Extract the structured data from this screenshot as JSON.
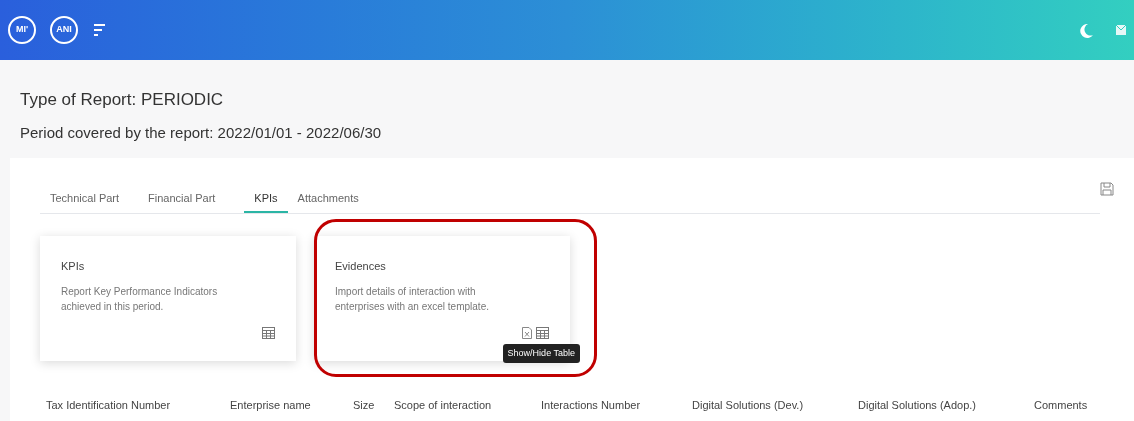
{
  "header": {
    "logos": [
      {
        "text": "MI'"
      },
      {
        "text": "ANI"
      }
    ]
  },
  "report": {
    "type": "Type of Report: PERIODIC",
    "period": "Period covered by the report: 2022/01/01 - 2022/06/30"
  },
  "tabs": [
    {
      "label": "Technical Part",
      "selected": false
    },
    {
      "label": "Financial Part",
      "selected": false
    },
    {
      "label": "KPIs",
      "selected": true
    },
    {
      "label": "Attachments",
      "selected": false
    }
  ],
  "cards": [
    {
      "title": "KPIs",
      "description": "Report Key Performance Indicators achieved in this period.",
      "excel_icon": false,
      "highlighted": false
    },
    {
      "title": "Evidences",
      "description": "Import details of interaction with enterprises with an excel template.",
      "excel_icon": true,
      "highlighted": true,
      "tooltip": "Show/Hide Table"
    }
  ],
  "table": {
    "columns": [
      "Tax Identification Number",
      "Enterprise name",
      "Size",
      "Scope of interaction",
      "Interactions Number",
      "Digital Solutions (Dev.)",
      "Digital Solutions (Adop.)",
      "Comments"
    ]
  }
}
